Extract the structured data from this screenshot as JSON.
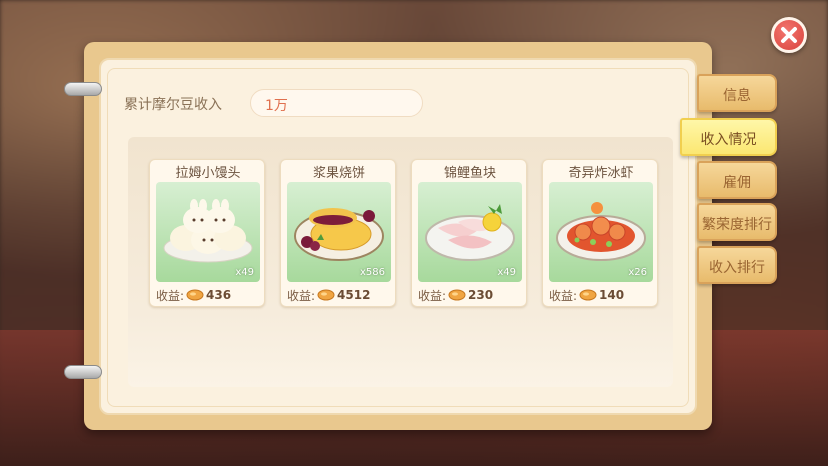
{
  "income": {
    "label": "累计摩尔豆收入",
    "value": "1万"
  },
  "tabs": [
    {
      "label": "信息",
      "active": false
    },
    {
      "label": "收入情况",
      "active": true
    },
    {
      "label": "雇佣",
      "active": false
    },
    {
      "label": "繁荣度排行",
      "active": false
    },
    {
      "label": "收入排行",
      "active": false
    }
  ],
  "dishes": [
    {
      "name": "拉姆小馒头",
      "count": "x49",
      "income_label": "收益:",
      "income": "436",
      "icon": "bun-dish-icon"
    },
    {
      "name": "浆果烧饼",
      "count": "x586",
      "income_label": "收益:",
      "income": "4512",
      "icon": "berry-pancake-dish-icon"
    },
    {
      "name": "锦鲤鱼块",
      "count": "x49",
      "income_label": "收益:",
      "income": "230",
      "icon": "fish-fillet-dish-icon"
    },
    {
      "name": "奇异炸冰虾",
      "count": "x26",
      "income_label": "收益:",
      "income": "140",
      "icon": "fried-shrimp-dish-icon"
    }
  ],
  "icons": {
    "close": "close-icon",
    "coin": "mole-bean-coin-icon"
  },
  "colors": {
    "accent_active_tab": "#fbe772",
    "tab": "#e8bb6c",
    "close": "#d9433d",
    "income_value": "#e0704e"
  }
}
